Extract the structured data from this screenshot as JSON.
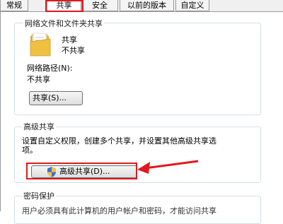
{
  "tabs": [
    {
      "label": "常规"
    },
    {
      "label": "共享"
    },
    {
      "label": "安全"
    },
    {
      "label": "以前的版本"
    },
    {
      "label": "自定义"
    }
  ],
  "network_sharing": {
    "title": "网络文件和文件夹共享",
    "item_name": "共享",
    "item_status": "不共享",
    "path_label": "网络路径(N):",
    "path_value": "不共享",
    "share_button": "共享(S)..."
  },
  "advanced_sharing": {
    "title": "高级共享",
    "description_line1": "设置自定义权限，创建多个共享，并设置其他高级共享选",
    "description_line2": "项。",
    "button_label": "高级共享(D)..."
  },
  "password_protection": {
    "title": "密码保护",
    "description_partial": "用户必须具有此计算机的用户帐户和密码，才能访问共享"
  },
  "colors": {
    "highlight": "#e0191f"
  },
  "icons": [
    "folder-icon",
    "shield-icon",
    "arrow-icon"
  ]
}
